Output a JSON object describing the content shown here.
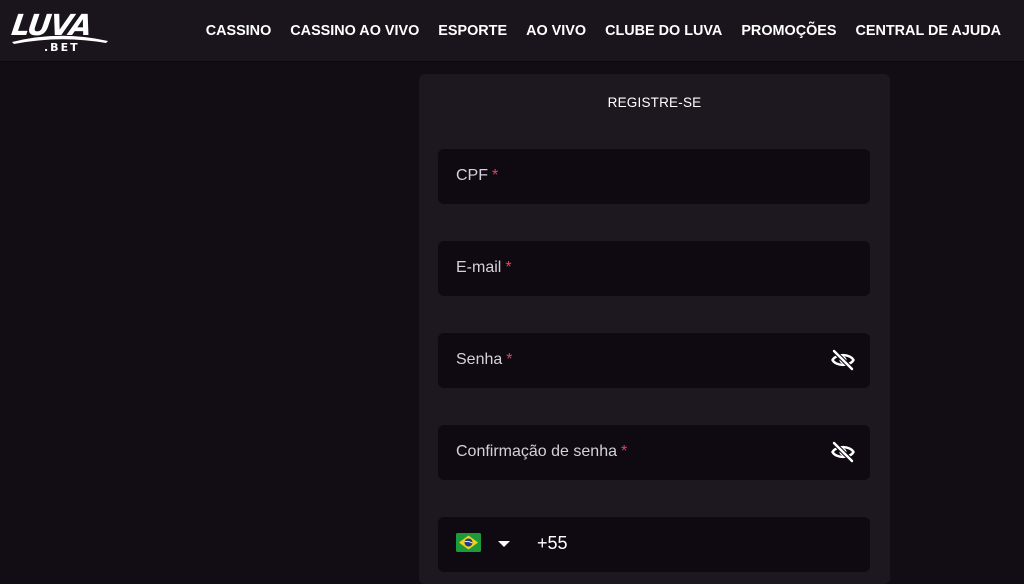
{
  "brand": {
    "name": "LUVA",
    "suffix": ".BET"
  },
  "nav": {
    "items": [
      {
        "label": "CASSINO"
      },
      {
        "label": "CASSINO AO VIVO"
      },
      {
        "label": "ESPORTE"
      },
      {
        "label": "AO VIVO"
      },
      {
        "label": "CLUBE DO LUVA"
      },
      {
        "label": "PROMOÇÕES"
      },
      {
        "label": "CENTRAL DE AJUDA"
      }
    ]
  },
  "form": {
    "title": "REGISTRE-SE",
    "required_mark": "*",
    "fields": {
      "cpf": {
        "label": "CPF"
      },
      "email": {
        "label": "E-mail"
      },
      "password": {
        "label": "Senha",
        "icon": "eye-off-icon"
      },
      "password_confirm": {
        "label": "Confirmação de senha",
        "icon": "eye-off-icon"
      },
      "phone": {
        "country_icon": "brazil-flag-icon",
        "dial_code": "+55"
      }
    }
  },
  "colors": {
    "background": "#120c14",
    "header": "#1a141c",
    "card": "#1d181f",
    "input": "#0f0a12",
    "required": "#e0455a",
    "text": "#ffffff"
  }
}
